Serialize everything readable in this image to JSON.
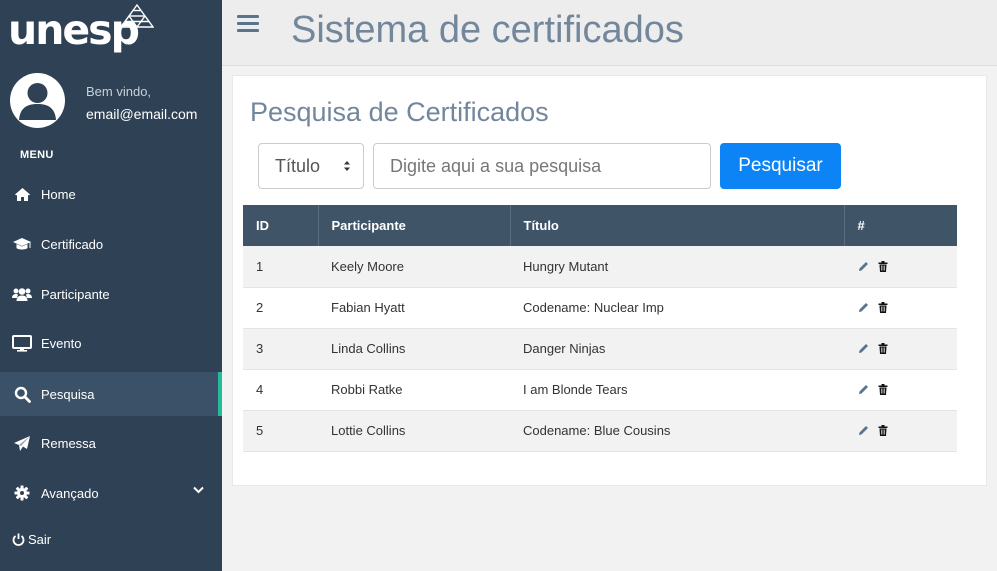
{
  "brand": {
    "name": "unesp"
  },
  "user": {
    "welcome": "Bem vindo,",
    "email": "email@email.com"
  },
  "sidebar": {
    "menu_label": "MENU",
    "items": [
      {
        "label": "Home",
        "icon": "home-icon"
      },
      {
        "label": "Certificado",
        "icon": "graduation-cap-icon"
      },
      {
        "label": "Participante",
        "icon": "users-icon"
      },
      {
        "label": "Evento",
        "icon": "desktop-icon"
      },
      {
        "label": "Pesquisa",
        "icon": "search-icon",
        "active": true
      },
      {
        "label": "Remessa",
        "icon": "paper-plane-icon"
      },
      {
        "label": "Avançado",
        "icon": "gear-icon"
      }
    ],
    "logout_label": "Sair"
  },
  "header": {
    "title": "Sistema de certificados"
  },
  "search": {
    "title": "Pesquisa de Certificados",
    "filter_selected": "Título",
    "placeholder": "Digite aqui a sua pesquisa",
    "button_label": "Pesquisar"
  },
  "table": {
    "headers": [
      "ID",
      "Participante",
      "Título",
      "#"
    ],
    "rows": [
      {
        "id": "1",
        "participante": "Keely Moore",
        "titulo": "Hungry Mutant"
      },
      {
        "id": "2",
        "participante": "Fabian Hyatt",
        "titulo": "Codename: Nuclear Imp"
      },
      {
        "id": "3",
        "participante": "Linda Collins",
        "titulo": "Danger Ninjas"
      },
      {
        "id": "4",
        "participante": "Robbi Ratke",
        "titulo": "I am Blonde Tears"
      },
      {
        "id": "5",
        "participante": "Lottie Collins",
        "titulo": "Codename: Blue Cousins"
      }
    ]
  },
  "colors": {
    "sidebar_bg": "#2f4154",
    "accent": "#26b99a",
    "primary_button": "#0d84f5",
    "table_header": "#405467",
    "title_text": "#73879c"
  }
}
